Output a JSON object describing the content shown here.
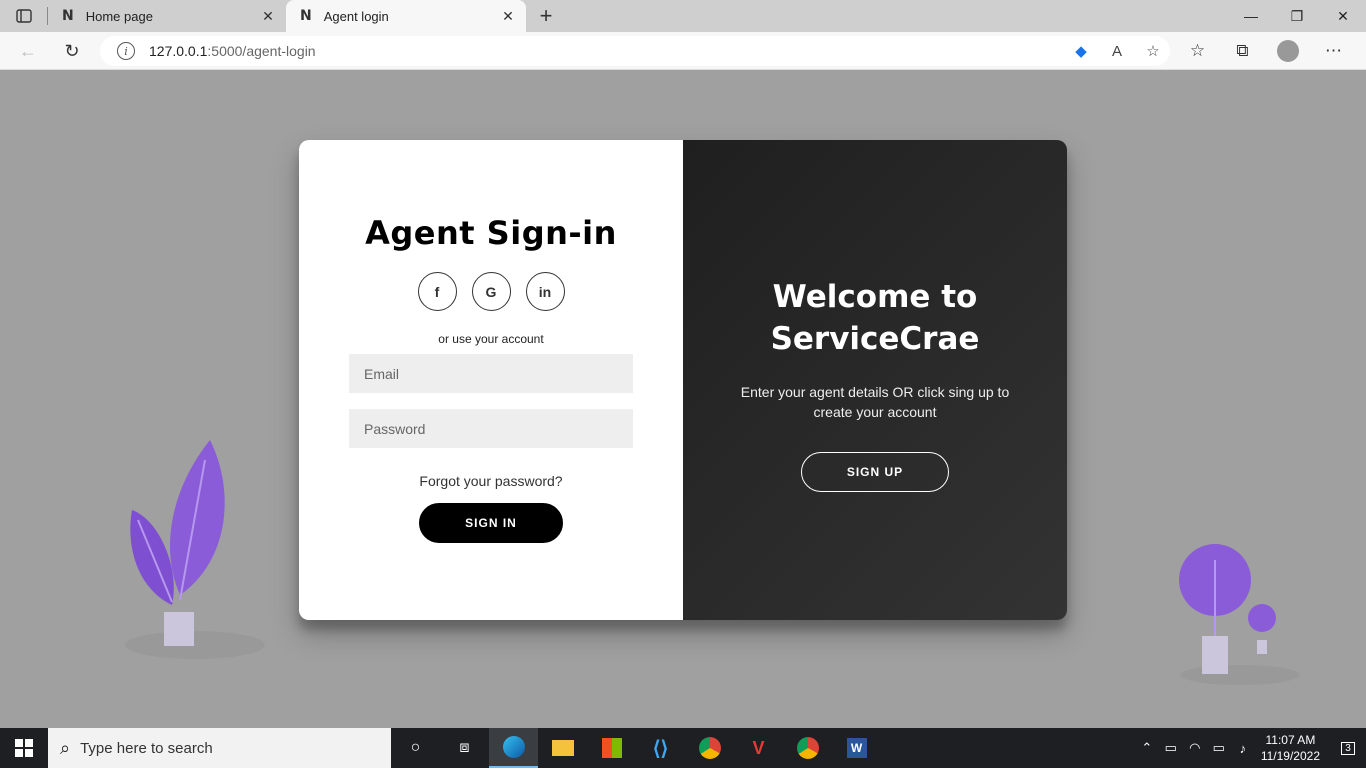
{
  "browser": {
    "tabs": [
      {
        "label": "Home page"
      },
      {
        "label": "Agent login"
      }
    ],
    "url_host": "127.0.0.1",
    "url_rest": ":5000/agent-login"
  },
  "login": {
    "title": "Agent Sign-in",
    "socials": [
      "f",
      "G",
      "in"
    ],
    "or_text": "or use your account",
    "email_placeholder": "Email",
    "password_placeholder": "Password",
    "forgot": "Forgot your password?",
    "signin_label": "SIGN IN"
  },
  "welcome": {
    "title_line1": "Welcome to",
    "title_line2": "ServiceCrae",
    "description": "Enter your agent details OR click sing up to create your account",
    "signup_label": "SIGN UP"
  },
  "taskbar": {
    "search_placeholder": "Type here to search",
    "time": "11:07 AM",
    "date": "11/19/2022",
    "notifications": "3"
  },
  "colors": {
    "page_bg": "#a0a0a0",
    "panel_dark": "#2a2a2a",
    "plant_purple": "#8a5cd8"
  }
}
